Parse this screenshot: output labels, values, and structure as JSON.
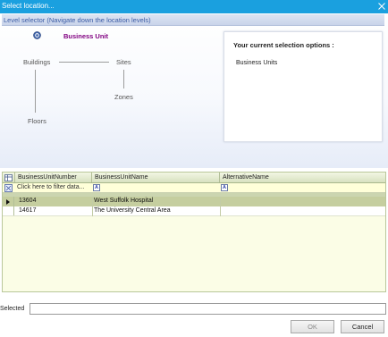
{
  "window": {
    "title": "Select location...",
    "close_glyph": "✕"
  },
  "level_selector": {
    "header": "Level selector (Navigate down the location levels)",
    "nav_icon": "navigate-up-icon",
    "nodes": {
      "business_unit": "Business Unit",
      "buildings": "Buildings",
      "sites": "Sites",
      "zones": "Zones",
      "floors": "Floors"
    },
    "current_level_color": "#800080"
  },
  "selection_options": {
    "title": "Your current selection options :",
    "value": "Business Units"
  },
  "grid": {
    "columns": [
      "BusinessUnitNumber",
      "BusinessUnitName",
      "AlternativeName"
    ],
    "filter_placeholder": "Click here to filter data...",
    "filter_icon_letter": "A",
    "rows": [
      {
        "number": "13604",
        "name": "West Suffolk Hospital",
        "alt": "",
        "selected": true
      },
      {
        "number": "14617",
        "name": "The University Central Area",
        "alt": "",
        "selected": false
      }
    ],
    "colors": {
      "header": "#d8e1c0",
      "background": "#fbfde6",
      "selected_row": "#c5ce9f",
      "filter_row": "#ffffd9"
    }
  },
  "footer": {
    "selected_label": "Selected",
    "selected_value": "",
    "ok_label": "OK",
    "cancel_label": "Cancel"
  },
  "colors": {
    "titlebar": "#1aa0df",
    "header_text": "#3b5ba5"
  }
}
